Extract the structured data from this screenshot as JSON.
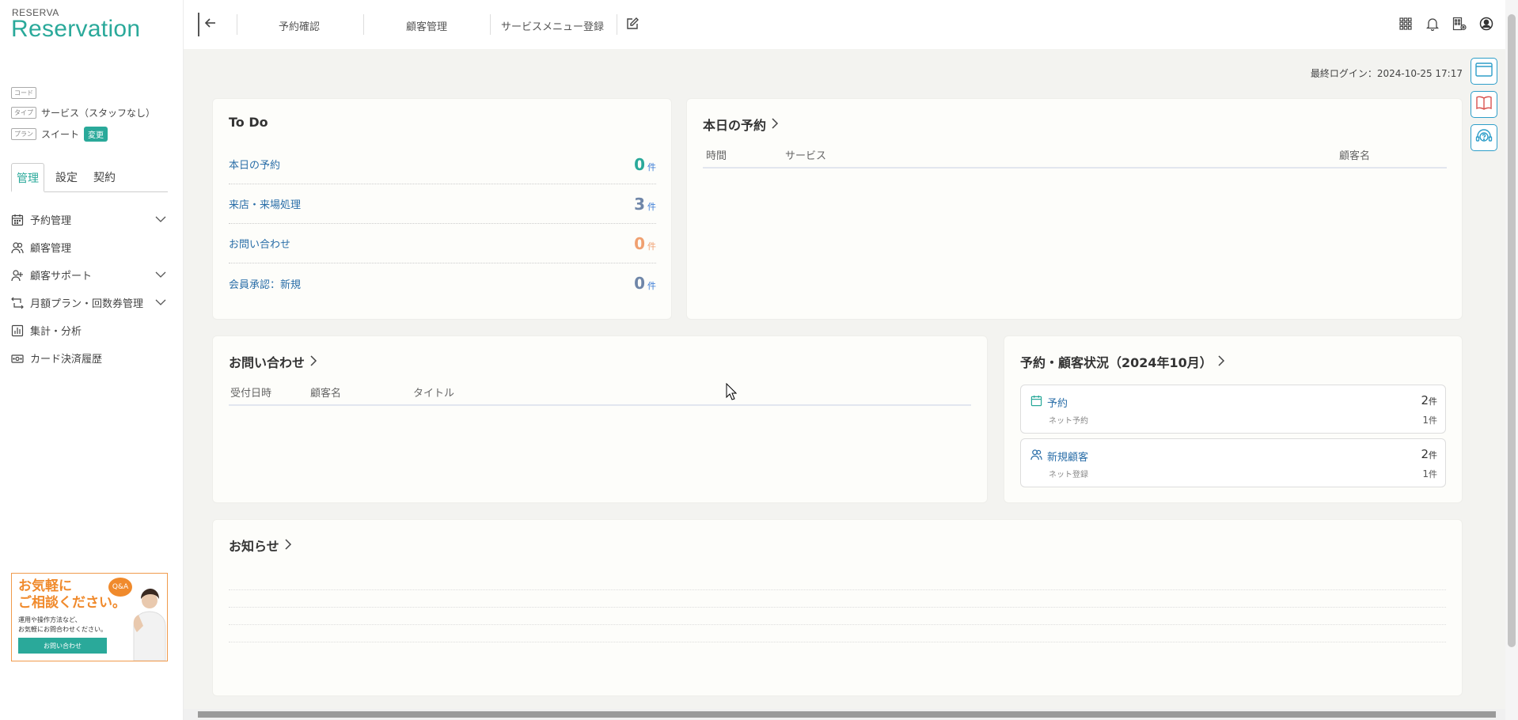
{
  "brand": {
    "small": "RESERVA",
    "big": "Reservation"
  },
  "account": {
    "code_tag": "コード",
    "type_tag": "タイプ",
    "type_value": "サービス（スタッフなし）",
    "plan_tag": "プラン",
    "plan_value": "スイート",
    "plan_change": "変更"
  },
  "side_tabs": [
    "管理",
    "設定",
    "契約"
  ],
  "nav": [
    {
      "label": "予約管理",
      "icon": "calendar-icon",
      "expand": true
    },
    {
      "label": "顧客管理",
      "icon": "users-icon",
      "expand": false
    },
    {
      "label": "顧客サポート",
      "icon": "user-support-icon",
      "expand": true
    },
    {
      "label": "月額プラン・回数券管理",
      "icon": "repeat-icon",
      "expand": true
    },
    {
      "label": "集計・分析",
      "icon": "chart-icon",
      "expand": false
    },
    {
      "label": "カード決済履歴",
      "icon": "card-icon",
      "expand": false
    }
  ],
  "promo": {
    "title_line1": "お気軽に",
    "title_line2": "ご相談ください。",
    "sub_line1": "運用や操作方法など、",
    "sub_line2": "お気軽にお問合わせください。",
    "button": "お問い合わせ",
    "badge": "Q&A"
  },
  "topnav": {
    "items": [
      "予約確認",
      "顧客管理",
      "サービスメニュー登録"
    ]
  },
  "last_login": "最終ログイン：2024-10-25 17:17",
  "todo": {
    "title": "To Do",
    "items": [
      {
        "label": "本日の予約",
        "count": "0",
        "unit": "件",
        "color": "#2aa99a"
      },
      {
        "label": "来店・来場処理",
        "count": "3",
        "unit": "件",
        "color": "#6f86a8"
      },
      {
        "label": "お問い合わせ",
        "count": "0",
        "unit": "件",
        "color": "#f0a070"
      },
      {
        "label": "会員承認：新規",
        "count": "0",
        "unit": "件",
        "color": "#6f86a8"
      }
    ]
  },
  "today": {
    "title": "本日の予約",
    "columns": [
      "時間",
      "サービス",
      "顧客名"
    ]
  },
  "inquiries": {
    "title": "お問い合わせ",
    "columns": [
      "受付日時",
      "顧客名",
      "タイトル"
    ]
  },
  "status": {
    "title": "予約・顧客状況（2024年10月）",
    "boxes": [
      {
        "label": "予約",
        "sub": "ネット予約",
        "main": "2",
        "minor": "1",
        "unit": "件",
        "icon": "calendar-icon"
      },
      {
        "label": "新規顧客",
        "sub": "ネット登録",
        "main": "2",
        "minor": "1",
        "unit": "件",
        "icon": "users-icon"
      }
    ]
  },
  "news": {
    "title": "お知らせ"
  },
  "colors": {
    "accent": "#2aa99a",
    "link": "#2a6ea8",
    "float_border": "#2e9ec9"
  }
}
